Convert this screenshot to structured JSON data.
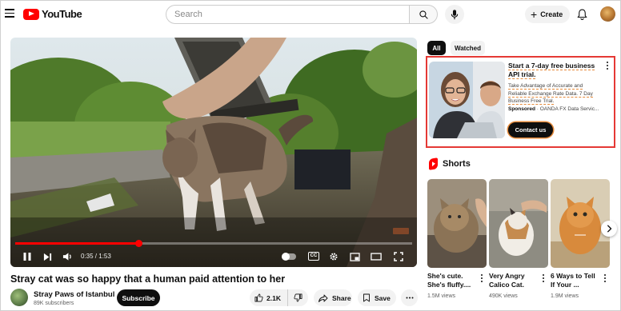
{
  "app": {
    "brand": "YouTube"
  },
  "header": {
    "search_placeholder": "Search",
    "create_label": "Create",
    "icons": [
      "menu-icon",
      "search-icon",
      "mic-icon",
      "plus-icon",
      "bell-icon"
    ]
  },
  "player": {
    "time_label": "0:35 / 1:53",
    "progress_fraction": 0.31,
    "cc_label": "CC"
  },
  "video": {
    "title": "Stray cat was so happy that a human paid attention to her",
    "channel_name": "Stray Paws of Istanbul",
    "subscribers": "89K subscribers",
    "subscribe_label": "Subscribe",
    "like_count": "2.1K",
    "share_label": "Share",
    "save_label": "Save"
  },
  "sidebar": {
    "chips": [
      {
        "label": "All",
        "active": true
      },
      {
        "label": "Watched",
        "active": false
      }
    ],
    "ad": {
      "title": "Start a 7-day free business API trial.",
      "description": "Take Advantage of Accurate and Reliable Exchange Rate Data. 7 Day Business Free Trial.",
      "sponsored_label": "Sponsored",
      "sponsor": "OANDA FX Data Servic...",
      "cta_label": "Contact us"
    },
    "shorts_title": "Shorts",
    "shorts": [
      {
        "title": "She's cute. She's fluffy....",
        "views": "1.5M views"
      },
      {
        "title": "Very Angry Calico Cat.",
        "views": "490K views"
      },
      {
        "title": "6 Ways to Tell If Your ...",
        "views": "1.9M views"
      }
    ]
  },
  "colors": {
    "brand_red": "#ff0000",
    "annotation_red": "#e53935",
    "annotation_orange": "#e58a3a"
  }
}
